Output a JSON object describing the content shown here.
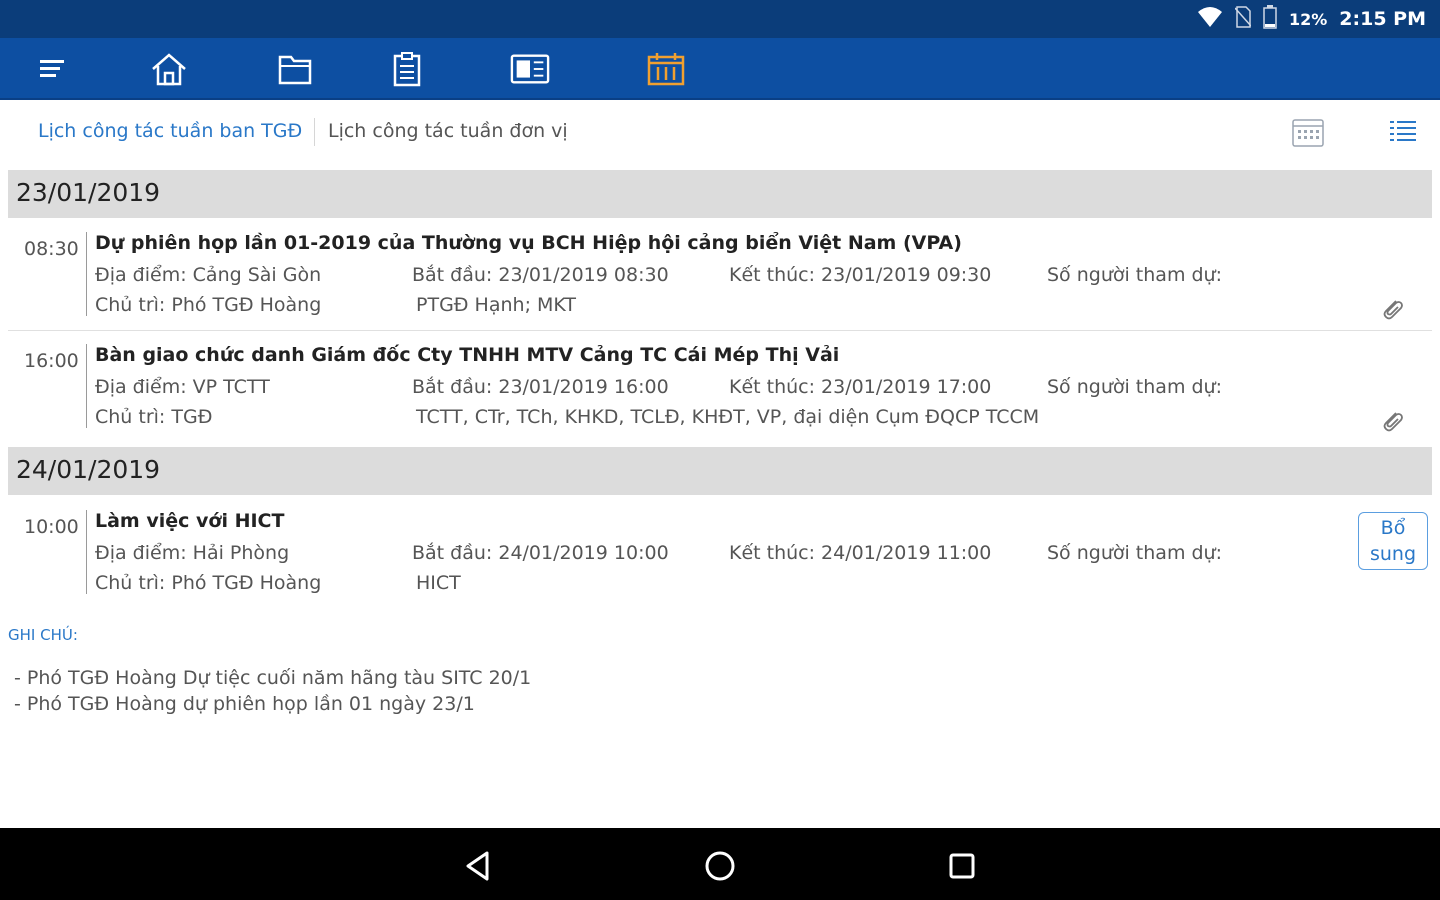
{
  "status_bar": {
    "battery": "12%",
    "time": "2:15 PM"
  },
  "toolbar": {
    "icons": [
      "menu-icon",
      "home-icon",
      "folder-icon",
      "clipboard-icon",
      "newspaper-icon",
      "calendar-icon"
    ],
    "active_color": "#f0a030"
  },
  "tabs": {
    "active_label": "Lịch công tác tuần ban TGĐ",
    "inactive_label": "Lịch công tác tuần đơn vị"
  },
  "days": [
    {
      "date": "23/01/2019",
      "events": [
        {
          "time": "08:30",
          "title": "Dự phiên họp lần 01-2019 của Thường vụ BCH Hiệp hội cảng biển Việt Nam (VPA)",
          "location": "Địa điểm: Cảng Sài Gòn",
          "start": "Bắt đầu: 23/01/2019 08:30",
          "end": "Kết thúc: 23/01/2019 09:30",
          "attendees_label": "Số người tham dự:",
          "host": "Chủ trì: Phó TGĐ Hoàng",
          "participants": "PTGĐ Hạnh; MKT"
        },
        {
          "time": "16:00",
          "title": "Bàn giao chức danh Giám đốc Cty TNHH MTV Cảng TC Cái Mép Thị Vải",
          "location": "Địa điểm: VP TCTT",
          "start": "Bắt đầu: 23/01/2019 16:00",
          "end": "Kết thúc: 23/01/2019 17:00",
          "attendees_label": "Số người tham dự:",
          "host": "Chủ trì: TGĐ",
          "participants": "TCTT, CTr, TCh, KHKD, TCLĐ, KHĐT, VP, đại diện Cụm ĐQCP TCCM"
        }
      ]
    },
    {
      "date": "24/01/2019",
      "events": [
        {
          "time": "10:00",
          "title": "Làm việc với HICT",
          "location": "Địa điểm: Hải Phòng",
          "start": "Bắt đầu: 24/01/2019 10:00",
          "end": "Kết thúc: 24/01/2019 11:00",
          "attendees_label": "Số người tham dự:",
          "host": "Chủ trì: Phó TGĐ Hoàng",
          "participants": "HICT",
          "action_line1": "Bổ",
          "action_line2": "sung"
        }
      ]
    }
  ],
  "notes": {
    "label": "GHI CHÚ:",
    "lines": [
      "- Phó TGĐ Hoàng Dự tiệc cuối năm hãng tàu SITC 20/1",
      "- Phó TGĐ Hoàng dự phiên họp lần 01 ngày 23/1"
    ]
  },
  "nav": [
    "back-icon",
    "home-circle-icon",
    "recents-icon"
  ]
}
